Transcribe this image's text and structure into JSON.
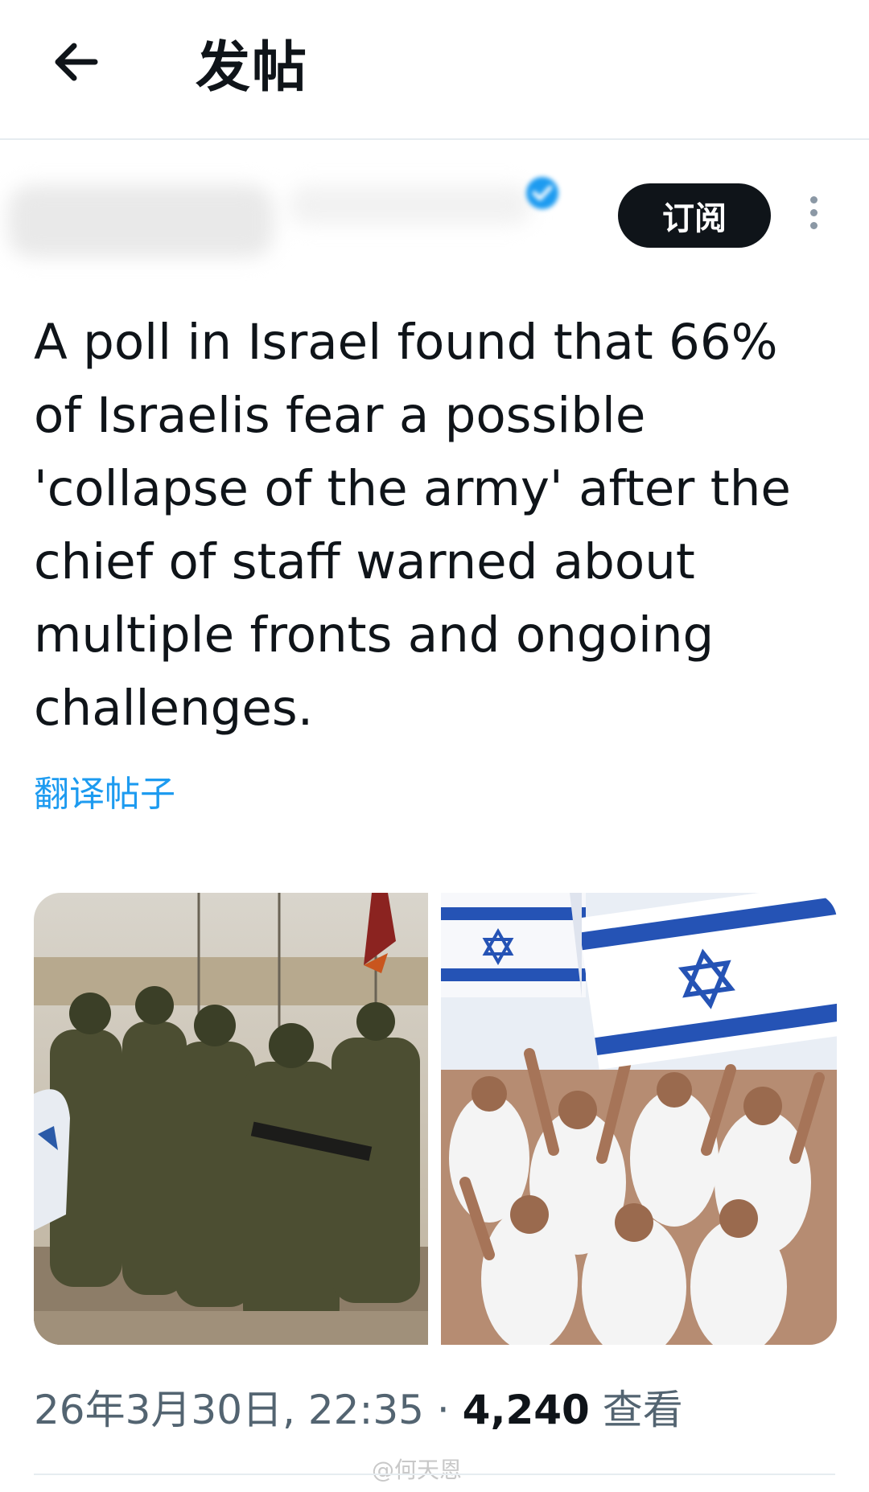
{
  "header": {
    "title": "发帖",
    "back_icon": "arrow-left-icon"
  },
  "author": {
    "verified_icon": "verified-badge-icon",
    "subscribe_label": "订阅",
    "more_icon": "more-vertical-icon"
  },
  "post": {
    "text": "A poll in Israel found that 66% of Israelis fear a possible 'collapse of the army' after the chief of staff warned about multiple fronts and ongoing challenges.",
    "translate_label": "翻译帖子"
  },
  "media": [
    {
      "name": "soldiers-photo"
    },
    {
      "name": "flags-crowd-photo"
    }
  ],
  "meta": {
    "timestamp": "26年3月30日, 22:35",
    "separator": "·",
    "views_count": "4,240",
    "views_label": "查看"
  },
  "watermark": "@何天恩",
  "colors": {
    "accent": "#1d9bf0",
    "text": "#0f1419",
    "muted": "#536471",
    "button_bg": "#0f1419"
  }
}
